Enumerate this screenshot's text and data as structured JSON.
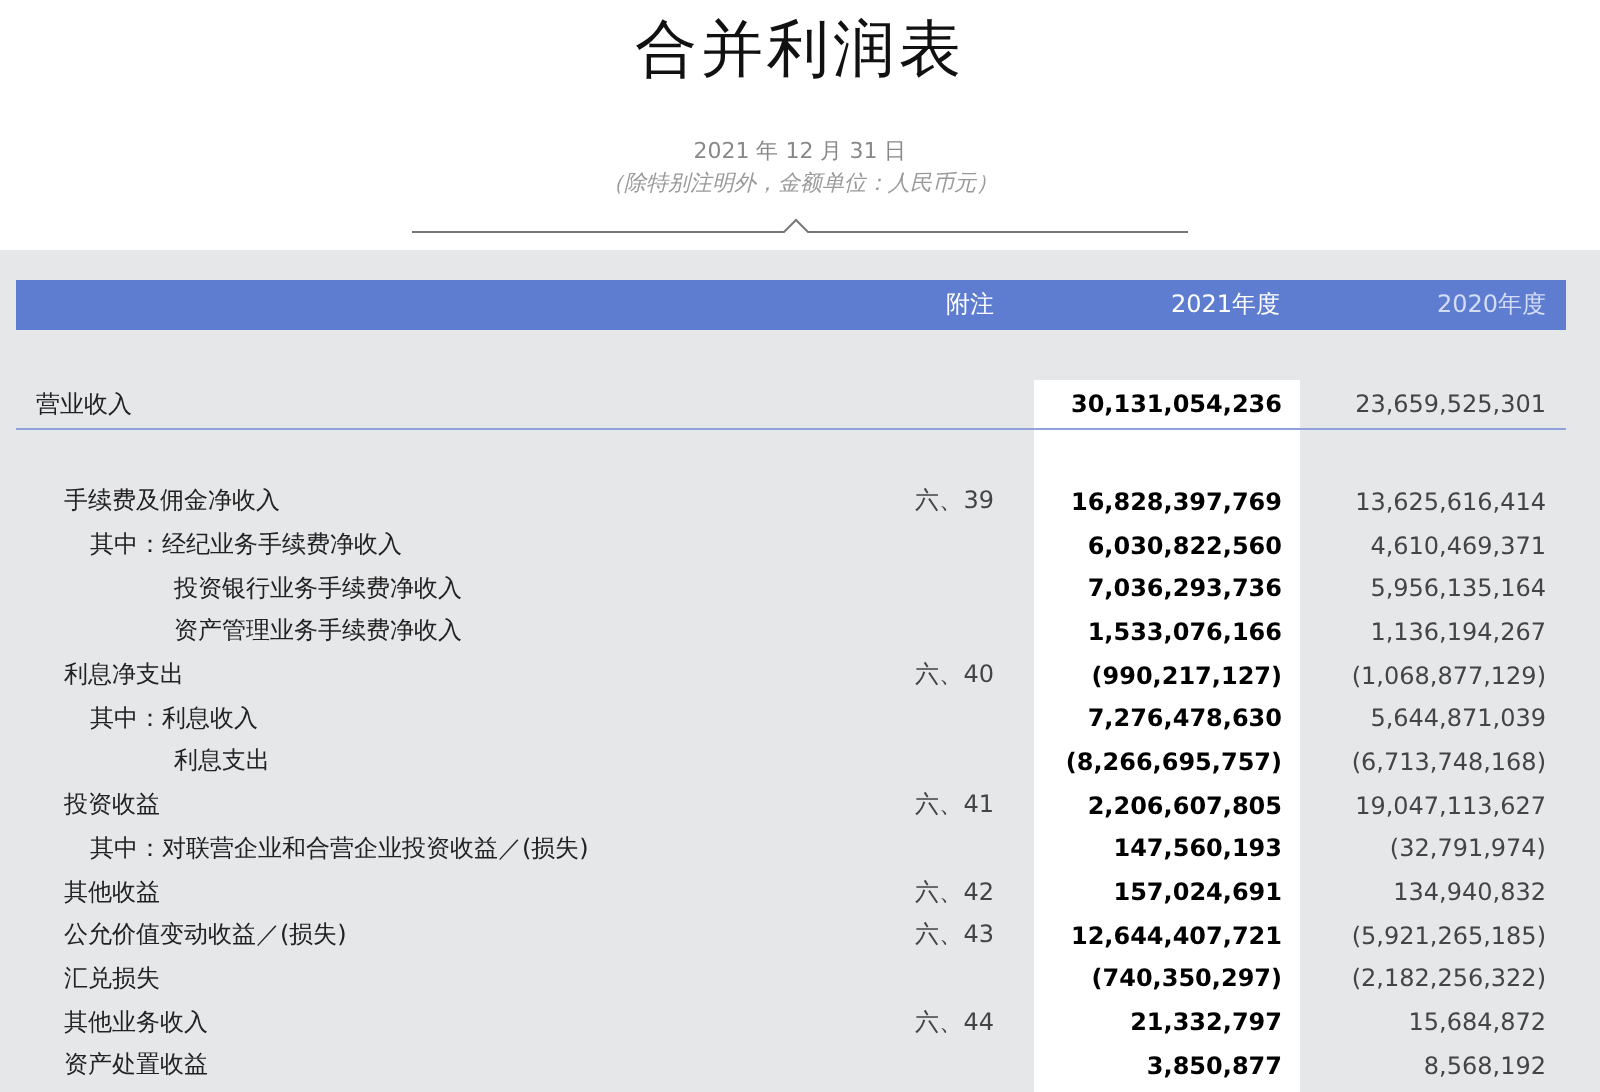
{
  "title": "合并利润表",
  "date": "2021 年 12 月 31 日",
  "unit_note": "（除特别注明外，金额单位：人民币元）",
  "columns": [
    {
      "label": "附注"
    },
    {
      "label": "2021年度"
    },
    {
      "label": "2020年度"
    }
  ],
  "rows": [
    {
      "label": "营业收入",
      "note": "",
      "current": "30,131,054,236",
      "previous": "23,659,525,301",
      "children": [
        {
          "label": "手续费及佣金净收入",
          "note": "六、39",
          "current": "16,828,397,769",
          "previous": "13,625,616,414",
          "children": [
            {
              "kind": "lead",
              "label": "其中：经纪业务手续费净收入",
              "current": "6,030,822,560",
              "previous": "4,610,469,371"
            },
            {
              "kind": "cont",
              "label": "投资银行业务手续费净收入",
              "current": "7,036,293,736",
              "previous": "5,956,135,164"
            },
            {
              "kind": "cont",
              "label": "资产管理业务手续费净收入",
              "current": "1,533,076,166",
              "previous": "1,136,194,267"
            }
          ]
        },
        {
          "label": "利息净支出",
          "note": "六、40",
          "current": "(990,217,127)",
          "previous": "(1,068,877,129)",
          "children": [
            {
              "kind": "lead",
              "label": "其中：利息收入",
              "current": "7,276,478,630",
              "previous": "5,644,871,039"
            },
            {
              "kind": "cont",
              "label": "利息支出",
              "current": "(8,266,695,757)",
              "previous": "(6,713,748,168)"
            }
          ]
        },
        {
          "label": "投资收益",
          "note": "六、41",
          "current": "2,206,607,805",
          "previous": "19,047,113,627",
          "children": [
            {
              "kind": "lead",
              "label": "其中：对联营企业和合营企业投资收益／(损失)",
              "current": "147,560,193",
              "previous": "(32,791,974)"
            }
          ]
        },
        {
          "label": "其他收益",
          "note": "六、42",
          "current": "157,024,691",
          "previous": "134,940,832"
        },
        {
          "label": "公允价值变动收益／(损失)",
          "note": "六、43",
          "current": "12,644,407,721",
          "previous": "(5,921,265,185)"
        },
        {
          "label": "汇兑损失",
          "current": "(740,350,297)",
          "previous": "(2,182,256,322)"
        },
        {
          "label": "其他业务收入",
          "note": "六、44",
          "current": "21,332,797",
          "previous": "15,684,872"
        },
        {
          "label": "资产处置收益",
          "current": "3,850,877",
          "previous": "8,568,192"
        }
      ]
    }
  ]
}
